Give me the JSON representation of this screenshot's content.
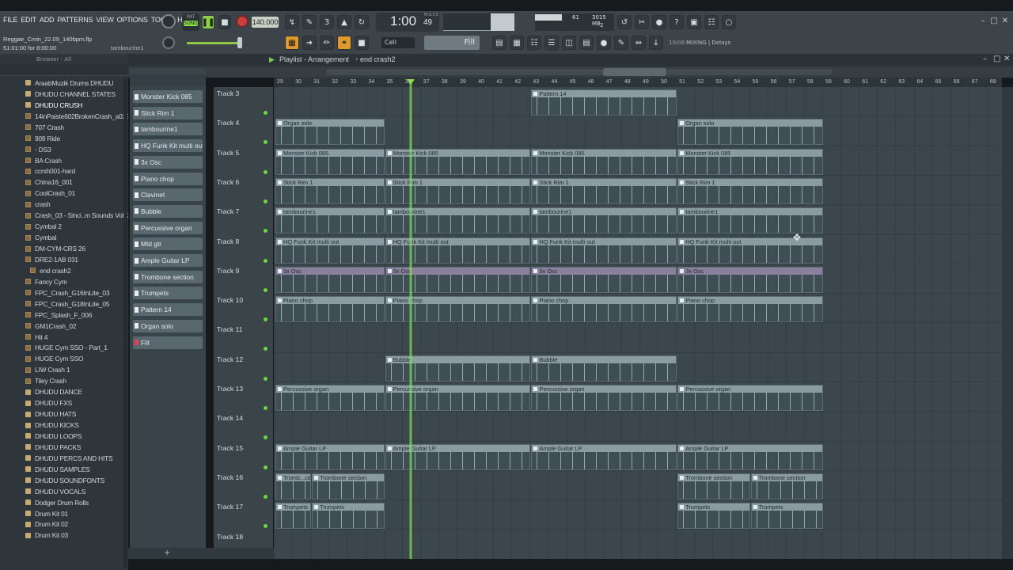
{
  "menu": [
    "FILE",
    "EDIT",
    "ADD",
    "PATTERNS",
    "VIEW",
    "OPTIONS",
    "TOOLS",
    "HELP"
  ],
  "transport": {
    "mode_pat": "PAT",
    "mode_song": "SONG",
    "tempo": "140.000",
    "time": "1:00",
    "time_small": "49",
    "time_label": "M:S:CS"
  },
  "cpu": {
    "mem": "3015 MB",
    "value": "61",
    "voices": "2"
  },
  "project": {
    "file": "Reggae_Cmin_22.09_140bpm.flp",
    "position": "51:01:00 for 8:00:00",
    "hint": "tambourine1"
  },
  "snap": {
    "value": "Cell"
  },
  "pattern_sel": {
    "value": "Fill"
  },
  "mixer_hint": {
    "value": "10/08",
    "label": "MIXING | Delays"
  },
  "browser": {
    "title": "Browser - All",
    "items": [
      {
        "label": "AraabMuzik Drums DHUDU",
        "type": "folder"
      },
      {
        "label": "DHUDU CHANNEL STATES",
        "type": "folder"
      },
      {
        "label": "DHUDU CRUSH",
        "type": "folder",
        "sel": true
      },
      {
        "label": "14inPaiste602BrokenCrash_a022",
        "type": "file"
      },
      {
        "label": "707 Crash",
        "type": "file"
      },
      {
        "label": "909 Ride",
        "type": "file"
      },
      {
        "label": "- DS3",
        "type": "file"
      },
      {
        "label": "BA Crash",
        "type": "file"
      },
      {
        "label": "ccrsh001-hard",
        "type": "file"
      },
      {
        "label": "China16_001",
        "type": "file"
      },
      {
        "label": "CoolCrash_01",
        "type": "file"
      },
      {
        "label": "crash",
        "type": "file"
      },
      {
        "label": "Crash_03 - Sinci..m Sounds Vol. 2",
        "type": "file"
      },
      {
        "label": "Cymbal 2",
        "type": "file"
      },
      {
        "label": "Cymbal",
        "type": "file"
      },
      {
        "label": "DM-CYM-CRS 26",
        "type": "file"
      },
      {
        "label": "DRE2-1AB 031",
        "type": "file"
      },
      {
        "label": "end crash2",
        "type": "file",
        "indent": true
      },
      {
        "label": "Fancy Cym",
        "type": "file"
      },
      {
        "label": "FPC_Crash_G16InLite_03",
        "type": "file"
      },
      {
        "label": "FPC_Crash_G18InLite_05",
        "type": "file"
      },
      {
        "label": "FPC_Splash_F_006",
        "type": "file"
      },
      {
        "label": "GM1Crash_02",
        "type": "file"
      },
      {
        "label": "Hit 4",
        "type": "file"
      },
      {
        "label": "HUGE Cym SSO - Part_1",
        "type": "file"
      },
      {
        "label": "HUGE Cym SSO",
        "type": "file"
      },
      {
        "label": "LIW Crash 1",
        "type": "file"
      },
      {
        "label": "Tiley Crash",
        "type": "file"
      },
      {
        "label": "DHUDU DANCE",
        "type": "folder"
      },
      {
        "label": "DHUDU FXS",
        "type": "folder"
      },
      {
        "label": "DHUDU HATS",
        "type": "folder"
      },
      {
        "label": "DHUDU KICKS",
        "type": "folder"
      },
      {
        "label": "DHUDU LOOPS",
        "type": "folder"
      },
      {
        "label": "DHUDU PACKS",
        "type": "folder"
      },
      {
        "label": "DHUDU PERCS AND HITS",
        "type": "folder"
      },
      {
        "label": "DHUDU SAMPLES",
        "type": "folder"
      },
      {
        "label": "DHUDU SOUNDFONTS",
        "type": "folder"
      },
      {
        "label": "DHUDU VOCALS",
        "type": "folder"
      },
      {
        "label": "Dodger Drum Rolls",
        "type": "folder"
      },
      {
        "label": "Drum Kit 01",
        "type": "folder"
      },
      {
        "label": "Drum Kit 02",
        "type": "folder"
      },
      {
        "label": "Drum Kit 03",
        "type": "folder"
      }
    ]
  },
  "playlist": {
    "title": "Playlist - Arrangement",
    "pattern": "end crash2",
    "ruler": [
      "29",
      "30",
      "31",
      "32",
      "33",
      "34",
      "35",
      "36",
      "37",
      "38",
      "39",
      "40",
      "41",
      "42",
      "43",
      "44",
      "45",
      "46",
      "47",
      "48",
      "49",
      "50",
      "51",
      "52",
      "53",
      "54",
      "55",
      "56",
      "57",
      "58",
      "59",
      "60",
      "61",
      "62",
      "63",
      "64",
      "65",
      "66",
      "67",
      "68"
    ],
    "channels": [
      "Monster Kick 085",
      "Stick Rim 1",
      "tambourine1",
      "HQ Funk Kit multi out",
      "3x Osc",
      "Piano chop",
      "Clavinet",
      "Bubble",
      "Percussive organ",
      "Mtd gtr",
      "Ample Guitar LP",
      "Trombone section",
      "Trumpets",
      "Pattern 14",
      "Organ solo",
      "Fill"
    ],
    "tracks": [
      "Track 3",
      "Track 4",
      "Track 5",
      "Track 6",
      "Track 7",
      "Track 8",
      "Track 9",
      "Track 10",
      "Track 11",
      "Track 12",
      "Track 13",
      "Track 14",
      "Track 15",
      "Track 16",
      "Track 17",
      "Track 18"
    ],
    "clips": [
      {
        "track": 0,
        "start": 14,
        "len": 8,
        "label": "Pattern 14"
      },
      {
        "track": 1,
        "start": 0,
        "len": 6,
        "label": "Organ solo"
      },
      {
        "track": 1,
        "start": 22,
        "len": 8,
        "label": "Organ solo"
      },
      {
        "track": 2,
        "start": 0,
        "len": 6,
        "label": "Monster Kick 085"
      },
      {
        "track": 2,
        "start": 6,
        "len": 8,
        "label": "Monster Kick 085"
      },
      {
        "track": 2,
        "start": 14,
        "len": 8,
        "label": "Monster Kick 085"
      },
      {
        "track": 2,
        "start": 22,
        "len": 8,
        "label": "Monster Kick 085"
      },
      {
        "track": 3,
        "start": 0,
        "len": 6,
        "label": "Stick Rim 1"
      },
      {
        "track": 3,
        "start": 6,
        "len": 8,
        "label": "Stick Rim 1"
      },
      {
        "track": 3,
        "start": 14,
        "len": 8,
        "label": "Stick Rim 1"
      },
      {
        "track": 3,
        "start": 22,
        "len": 8,
        "label": "Stick Rim 1"
      },
      {
        "track": 4,
        "start": 0,
        "len": 6,
        "label": "tambourine1"
      },
      {
        "track": 4,
        "start": 6,
        "len": 8,
        "label": "tambourine1"
      },
      {
        "track": 4,
        "start": 14,
        "len": 8,
        "label": "tambourine1"
      },
      {
        "track": 4,
        "start": 22,
        "len": 8,
        "label": "tambourine1"
      },
      {
        "track": 5,
        "start": 0,
        "len": 6,
        "label": "HQ Funk Kit multi out"
      },
      {
        "track": 5,
        "start": 6,
        "len": 8,
        "label": "HQ Funk Kit multi out"
      },
      {
        "track": 5,
        "start": 14,
        "len": 8,
        "label": "HQ Funk Kit multi out"
      },
      {
        "track": 5,
        "start": 22,
        "len": 8,
        "label": "HQ Funk Kit multi out"
      },
      {
        "track": 6,
        "start": 0,
        "len": 6,
        "label": "3x Osc",
        "purple": true
      },
      {
        "track": 6,
        "start": 6,
        "len": 8,
        "label": "3x Osc",
        "purple": true
      },
      {
        "track": 6,
        "start": 14,
        "len": 8,
        "label": "3x Osc",
        "purple": true
      },
      {
        "track": 6,
        "start": 22,
        "len": 8,
        "label": "3x Osc",
        "purple": true
      },
      {
        "track": 7,
        "start": 0,
        "len": 6,
        "label": "Piano chop"
      },
      {
        "track": 7,
        "start": 6,
        "len": 8,
        "label": "Piano chop"
      },
      {
        "track": 7,
        "start": 14,
        "len": 8,
        "label": "Piano chop"
      },
      {
        "track": 7,
        "start": 22,
        "len": 8,
        "label": "Piano chop"
      },
      {
        "track": 9,
        "start": 6,
        "len": 8,
        "label": "Bubble"
      },
      {
        "track": 9,
        "start": 14,
        "len": 8,
        "label": "Bubble"
      },
      {
        "track": 10,
        "start": 0,
        "len": 6,
        "label": "Percussive organ"
      },
      {
        "track": 10,
        "start": 6,
        "len": 8,
        "label": "Percussive organ"
      },
      {
        "track": 10,
        "start": 14,
        "len": 8,
        "label": "Percussive organ"
      },
      {
        "track": 10,
        "start": 22,
        "len": 8,
        "label": "Percussive organ"
      },
      {
        "track": 12,
        "start": 0,
        "len": 6,
        "label": "Ample Guitar LP"
      },
      {
        "track": 12,
        "start": 6,
        "len": 8,
        "label": "Ample Guitar LP"
      },
      {
        "track": 12,
        "start": 14,
        "len": 8,
        "label": "Ample Guitar LP"
      },
      {
        "track": 12,
        "start": 22,
        "len": 8,
        "label": "Ample Guitar LP"
      },
      {
        "track": 13,
        "start": 0,
        "len": 2,
        "label": "Tromb...ction"
      },
      {
        "track": 13,
        "start": 2,
        "len": 4,
        "label": "Trombone section"
      },
      {
        "track": 13,
        "start": 22,
        "len": 4,
        "label": "Trombone section"
      },
      {
        "track": 13,
        "start": 26,
        "len": 4,
        "label": "Trombone section"
      },
      {
        "track": 14,
        "start": 0,
        "len": 2,
        "label": "Trumpets"
      },
      {
        "track": 14,
        "start": 2,
        "len": 4,
        "label": "Trumpets"
      },
      {
        "track": 14,
        "start": 22,
        "len": 4,
        "label": "Trumpets"
      },
      {
        "track": 14,
        "start": 26,
        "len": 4,
        "label": "Trumpets"
      }
    ]
  }
}
